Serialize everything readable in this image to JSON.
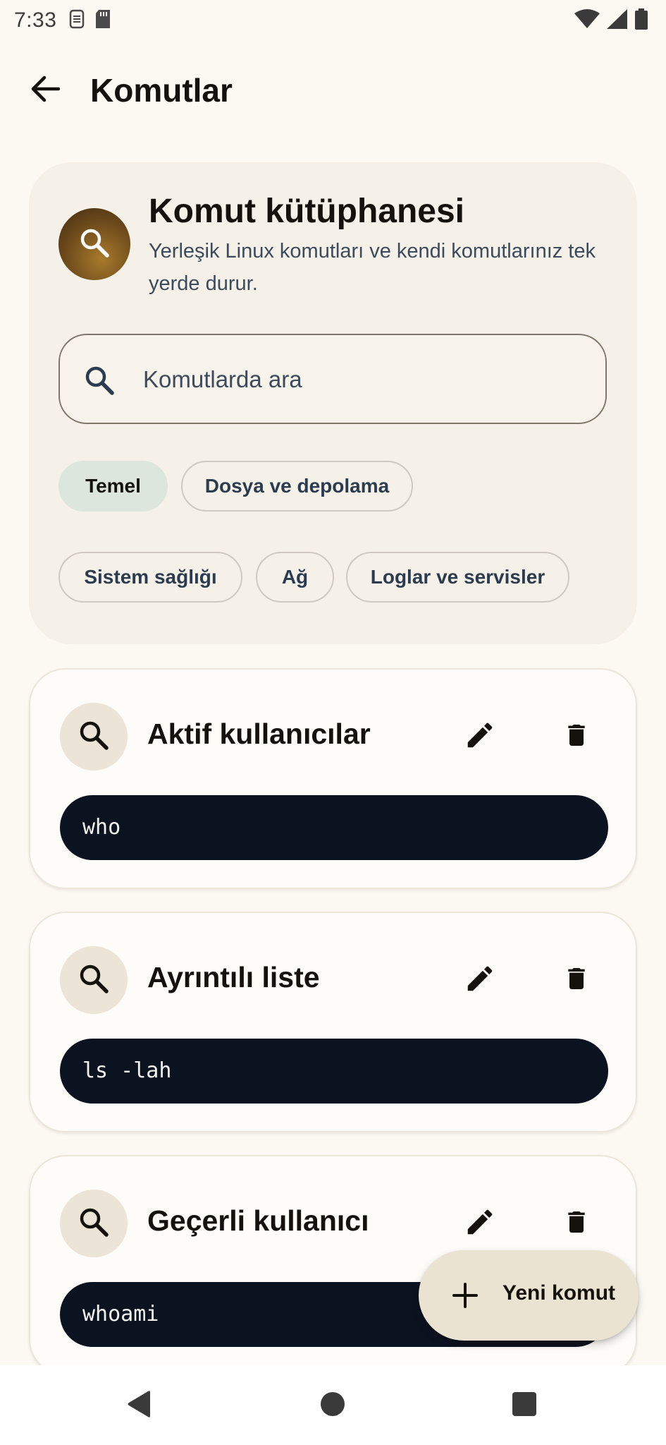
{
  "status_bar": {
    "time": "7:33",
    "left_icons": [
      "sim-icon",
      "sd-card-icon"
    ],
    "right_icons": [
      "wifi-icon",
      "signal-icon",
      "battery-icon"
    ]
  },
  "app_bar": {
    "title": "Komutlar",
    "back_icon": "arrow-left-icon"
  },
  "hero": {
    "icon": "search-icon",
    "title": "Komut kütüphanesi",
    "subtitle": "Yerleşik Linux komutları ve kendi komutlarınız tek yerde durur."
  },
  "search": {
    "placeholder": "Komutlarda ara",
    "value": ""
  },
  "filters": [
    {
      "label": "Temel",
      "selected": true
    },
    {
      "label": "Dosya ve depolama",
      "selected": false
    },
    {
      "label": "Sistem sağlığı",
      "selected": false
    },
    {
      "label": "Ağ",
      "selected": false
    },
    {
      "label": "Loglar ve servisler",
      "selected": false
    }
  ],
  "commands": [
    {
      "title": "Aktif kullanıcılar",
      "command": "who"
    },
    {
      "title": "Ayrıntılı liste",
      "command": "ls -lah"
    },
    {
      "title": "Geçerli kullanıcı",
      "command": "whoami"
    }
  ],
  "fab": {
    "label": "Yeni komut",
    "icon": "plus-icon"
  },
  "nav": {
    "icons": [
      "back-triangle-icon",
      "home-circle-icon",
      "recents-square-icon"
    ]
  },
  "colors": {
    "background": "#fcf9f2",
    "hero_card": "#f6f1e8",
    "selected_chip": "#dce6dc",
    "code_block": "#0c1320",
    "fab": "#ebe3d2",
    "subtitle_text": "#3b4a5c"
  }
}
